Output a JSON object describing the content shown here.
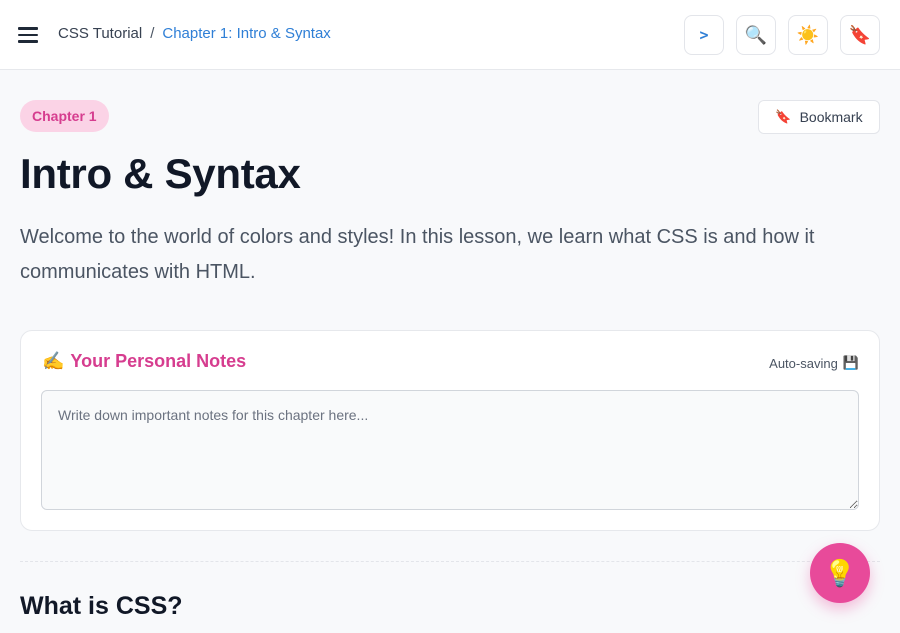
{
  "breadcrumb": {
    "root": "CSS Tutorial",
    "separator": "/",
    "current": "Chapter 1: Intro & Syntax"
  },
  "toolbar": {
    "code_label": ">",
    "search_icon": "🔍",
    "theme_icon": "☀️",
    "bookmark_icon": "🔖"
  },
  "chapter": {
    "badge": "Chapter 1",
    "title": "Intro & Syntax",
    "intro": "Welcome to the world of colors and styles! In this lesson, we learn what CSS is and how it communicates with HTML."
  },
  "bookmark_button": {
    "icon": "🔖",
    "label": "Bookmark"
  },
  "notes": {
    "icon": "✍️",
    "title": "Your Personal Notes",
    "autosave_label": "Auto-saving",
    "autosave_icon": "💾",
    "placeholder": "Write down important notes for this chapter here...",
    "value": ""
  },
  "section": {
    "heading": "What is CSS?"
  },
  "fab": {
    "icon": "💡"
  },
  "colors": {
    "accent_pink": "#d63d8f",
    "link_blue": "#2f7fd6",
    "fab_pink": "#e84a9a"
  }
}
